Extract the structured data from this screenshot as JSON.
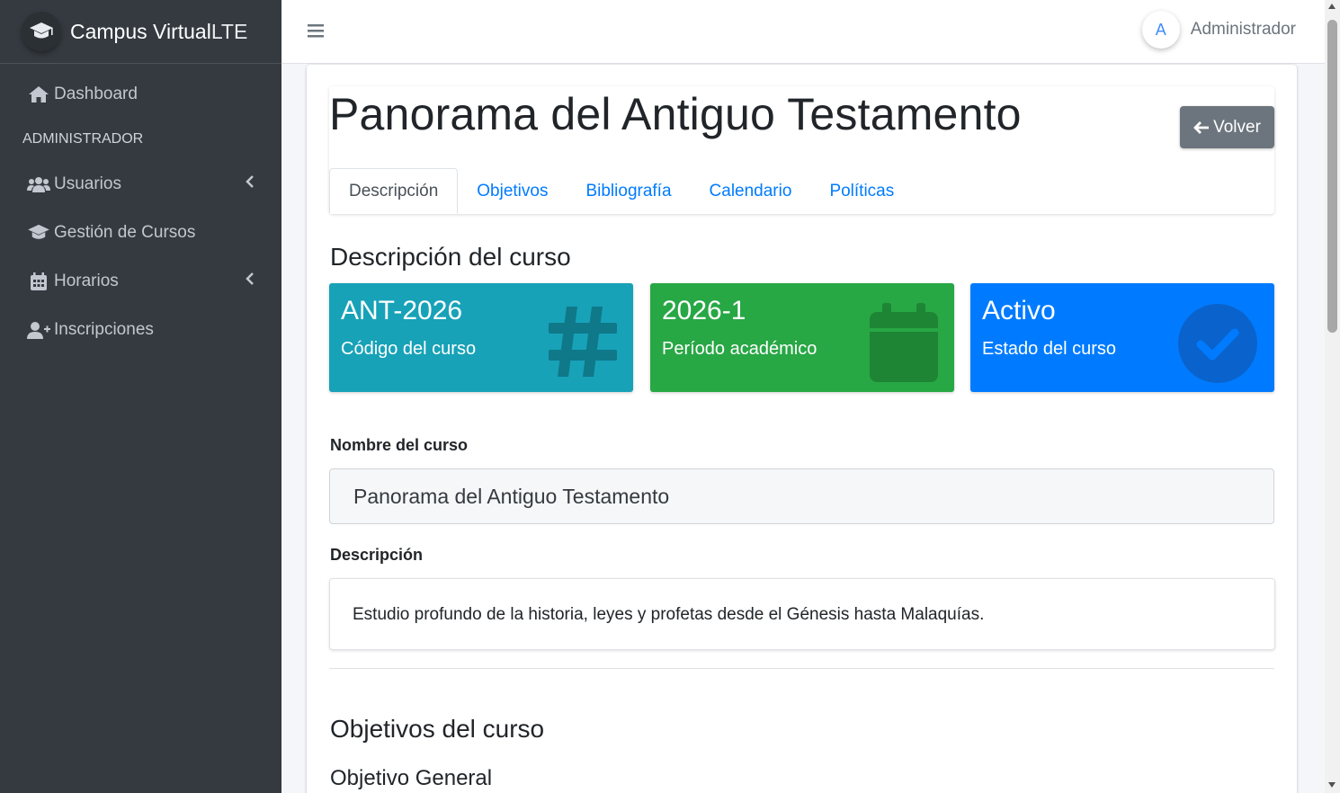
{
  "brand": {
    "name": "Campus Virtual",
    "suffix": "LTE",
    "icon": "graduation-cap-icon"
  },
  "sidebar": {
    "items": [
      {
        "label": "Dashboard",
        "icon": "home-icon"
      },
      {
        "label": "Usuarios",
        "icon": "users-icon",
        "has_submenu": true
      },
      {
        "label": "Gestión de Cursos",
        "icon": "graduation-cap-icon"
      },
      {
        "label": "Horarios",
        "icon": "calendar-icon",
        "has_submenu": true
      },
      {
        "label": "Inscripciones",
        "icon": "user-plus-icon"
      }
    ],
    "section_header": "ADMINISTRADOR"
  },
  "topbar": {
    "menu_icon": "bars-icon",
    "user": {
      "initial": "A",
      "name": "Administrador"
    }
  },
  "page": {
    "title": "Panorama del Antiguo Testamento",
    "back_button": "Volver",
    "tabs": [
      {
        "label": "Descripción",
        "active": true
      },
      {
        "label": "Objetivos",
        "active": false
      },
      {
        "label": "Bibliografía",
        "active": false
      },
      {
        "label": "Calendario",
        "active": false
      },
      {
        "label": "Políticas",
        "active": false
      }
    ]
  },
  "description_section": {
    "title": "Descripción del curso",
    "info_boxes": [
      {
        "value": "ANT-2026",
        "label": "Código del curso",
        "icon": "hashtag-icon",
        "color": "#17a2b8"
      },
      {
        "value": "2026-1",
        "label": "Período académico",
        "icon": "calendar-icon",
        "color": "#28a745"
      },
      {
        "value": "Activo",
        "label": "Estado del curso",
        "icon": "check-circle-icon",
        "color": "#007bff"
      }
    ],
    "name_label": "Nombre del curso",
    "name_value": "Panorama del Antiguo Testamento",
    "desc_label": "Descripción",
    "desc_value": "Estudio profundo de la historia, leyes y profetas desde el Génesis hasta Malaquías."
  },
  "objectives_section": {
    "title": "Objetivos del curso",
    "subtitle": "Objetivo General"
  }
}
